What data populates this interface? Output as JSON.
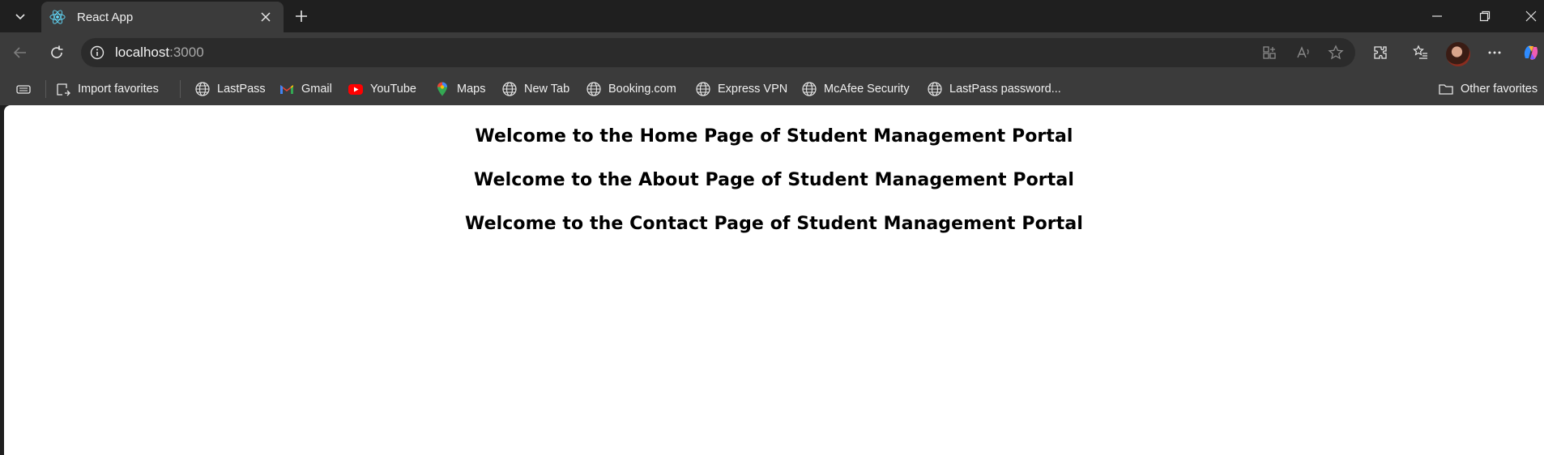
{
  "tab": {
    "title": "React App"
  },
  "address": {
    "host": "localhost",
    "port": ":3000"
  },
  "favorites": [
    {
      "label": "Import favorites",
      "icon": "import-favorites-icon"
    },
    {
      "label": "LastPass",
      "icon": "globe-icon"
    },
    {
      "label": "Gmail",
      "icon": "gmail-icon"
    },
    {
      "label": "YouTube",
      "icon": "youtube-icon"
    },
    {
      "label": "Maps",
      "icon": "maps-icon"
    },
    {
      "label": "New Tab",
      "icon": "globe-icon"
    },
    {
      "label": "Booking.com",
      "icon": "globe-icon"
    },
    {
      "label": "Express VPN",
      "icon": "globe-icon"
    },
    {
      "label": "McAfee Security",
      "icon": "globe-icon"
    },
    {
      "label": "LastPass password...",
      "icon": "globe-icon"
    }
  ],
  "other_favorites": "Other favorites",
  "page": {
    "headings": [
      "Welcome to the Home Page of Student Management Portal",
      "Welcome to the About Page of Student Management Portal",
      "Welcome to the Contact Page of Student Management Portal"
    ]
  },
  "colors": {
    "frame": "#1f1f1f",
    "toolbar": "#3b3b3b",
    "omnibox": "#2b2b2b",
    "page": "#ffffff",
    "react_blue": "#61dafb"
  }
}
